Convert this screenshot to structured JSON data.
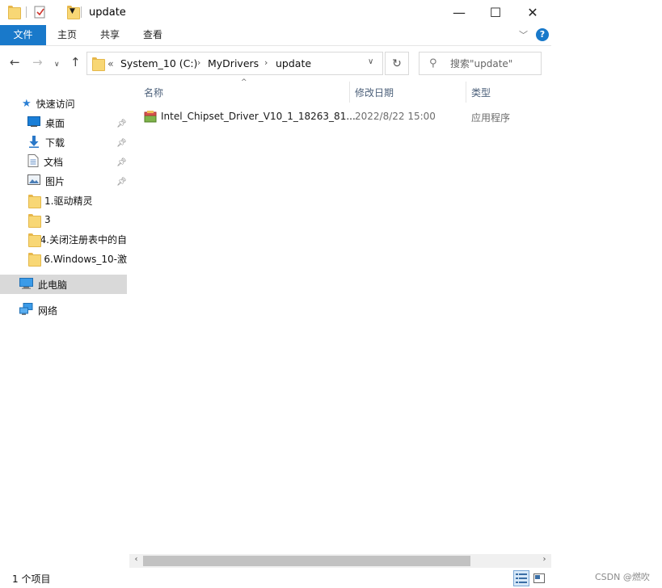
{
  "window": {
    "title": "update",
    "minimize": "—",
    "maximize": "☐",
    "close": "✕"
  },
  "ribbon": {
    "tabs": [
      "文件",
      "主页",
      "共享",
      "查看"
    ],
    "expand_icon": "chevron-down-icon",
    "help_label": "?"
  },
  "address": {
    "prefix": "«",
    "crumbs": [
      "System_10 (C:)",
      "MyDrivers",
      "update"
    ]
  },
  "search": {
    "placeholder": "搜索\"update\""
  },
  "sidebar": {
    "quick_access": "快速访问",
    "pinned": [
      {
        "label": "桌面",
        "icon": "desktop-icon"
      },
      {
        "label": "下载",
        "icon": "download-icon"
      },
      {
        "label": "文档",
        "icon": "document-icon"
      },
      {
        "label": "图片",
        "icon": "picture-icon"
      }
    ],
    "folders": [
      {
        "label": "1.驱动精灵"
      },
      {
        "label": "3"
      },
      {
        "label": "4.关闭注册表中的自"
      },
      {
        "label": "6.Windows_10-激"
      }
    ],
    "this_pc": "此电脑",
    "network": "网络"
  },
  "filelist": {
    "columns": {
      "name": "名称",
      "date": "修改日期",
      "type": "类型"
    },
    "rows": [
      {
        "name": "Intel_Chipset_Driver_V10_1_18263_81...",
        "date": "2022/8/22 15:00",
        "type": "应用程序",
        "icon": "installer-icon"
      }
    ]
  },
  "status": {
    "count": "1 个项目"
  },
  "watermark": "CSDN @燃吹",
  "colors": {
    "accent": "#1979ca",
    "folder": "#f8d775",
    "header_text": "#4c607a",
    "selected": "#d9d9d9"
  }
}
